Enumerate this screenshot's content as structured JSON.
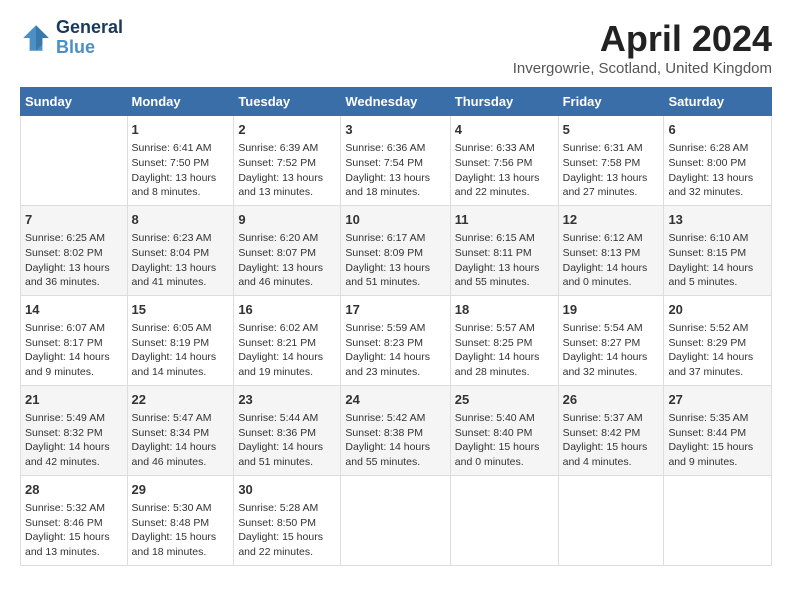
{
  "header": {
    "logo_line1": "General",
    "logo_line2": "Blue",
    "month": "April 2024",
    "location": "Invergowrie, Scotland, United Kingdom"
  },
  "columns": [
    "Sunday",
    "Monday",
    "Tuesday",
    "Wednesday",
    "Thursday",
    "Friday",
    "Saturday"
  ],
  "weeks": [
    [
      {
        "day": "",
        "sunrise": "",
        "sunset": "",
        "daylight": ""
      },
      {
        "day": "1",
        "sunrise": "Sunrise: 6:41 AM",
        "sunset": "Sunset: 7:50 PM",
        "daylight": "Daylight: 13 hours and 8 minutes."
      },
      {
        "day": "2",
        "sunrise": "Sunrise: 6:39 AM",
        "sunset": "Sunset: 7:52 PM",
        "daylight": "Daylight: 13 hours and 13 minutes."
      },
      {
        "day": "3",
        "sunrise": "Sunrise: 6:36 AM",
        "sunset": "Sunset: 7:54 PM",
        "daylight": "Daylight: 13 hours and 18 minutes."
      },
      {
        "day": "4",
        "sunrise": "Sunrise: 6:33 AM",
        "sunset": "Sunset: 7:56 PM",
        "daylight": "Daylight: 13 hours and 22 minutes."
      },
      {
        "day": "5",
        "sunrise": "Sunrise: 6:31 AM",
        "sunset": "Sunset: 7:58 PM",
        "daylight": "Daylight: 13 hours and 27 minutes."
      },
      {
        "day": "6",
        "sunrise": "Sunrise: 6:28 AM",
        "sunset": "Sunset: 8:00 PM",
        "daylight": "Daylight: 13 hours and 32 minutes."
      }
    ],
    [
      {
        "day": "7",
        "sunrise": "Sunrise: 6:25 AM",
        "sunset": "Sunset: 8:02 PM",
        "daylight": "Daylight: 13 hours and 36 minutes."
      },
      {
        "day": "8",
        "sunrise": "Sunrise: 6:23 AM",
        "sunset": "Sunset: 8:04 PM",
        "daylight": "Daylight: 13 hours and 41 minutes."
      },
      {
        "day": "9",
        "sunrise": "Sunrise: 6:20 AM",
        "sunset": "Sunset: 8:07 PM",
        "daylight": "Daylight: 13 hours and 46 minutes."
      },
      {
        "day": "10",
        "sunrise": "Sunrise: 6:17 AM",
        "sunset": "Sunset: 8:09 PM",
        "daylight": "Daylight: 13 hours and 51 minutes."
      },
      {
        "day": "11",
        "sunrise": "Sunrise: 6:15 AM",
        "sunset": "Sunset: 8:11 PM",
        "daylight": "Daylight: 13 hours and 55 minutes."
      },
      {
        "day": "12",
        "sunrise": "Sunrise: 6:12 AM",
        "sunset": "Sunset: 8:13 PM",
        "daylight": "Daylight: 14 hours and 0 minutes."
      },
      {
        "day": "13",
        "sunrise": "Sunrise: 6:10 AM",
        "sunset": "Sunset: 8:15 PM",
        "daylight": "Daylight: 14 hours and 5 minutes."
      }
    ],
    [
      {
        "day": "14",
        "sunrise": "Sunrise: 6:07 AM",
        "sunset": "Sunset: 8:17 PM",
        "daylight": "Daylight: 14 hours and 9 minutes."
      },
      {
        "day": "15",
        "sunrise": "Sunrise: 6:05 AM",
        "sunset": "Sunset: 8:19 PM",
        "daylight": "Daylight: 14 hours and 14 minutes."
      },
      {
        "day": "16",
        "sunrise": "Sunrise: 6:02 AM",
        "sunset": "Sunset: 8:21 PM",
        "daylight": "Daylight: 14 hours and 19 minutes."
      },
      {
        "day": "17",
        "sunrise": "Sunrise: 5:59 AM",
        "sunset": "Sunset: 8:23 PM",
        "daylight": "Daylight: 14 hours and 23 minutes."
      },
      {
        "day": "18",
        "sunrise": "Sunrise: 5:57 AM",
        "sunset": "Sunset: 8:25 PM",
        "daylight": "Daylight: 14 hours and 28 minutes."
      },
      {
        "day": "19",
        "sunrise": "Sunrise: 5:54 AM",
        "sunset": "Sunset: 8:27 PM",
        "daylight": "Daylight: 14 hours and 32 minutes."
      },
      {
        "day": "20",
        "sunrise": "Sunrise: 5:52 AM",
        "sunset": "Sunset: 8:29 PM",
        "daylight": "Daylight: 14 hours and 37 minutes."
      }
    ],
    [
      {
        "day": "21",
        "sunrise": "Sunrise: 5:49 AM",
        "sunset": "Sunset: 8:32 PM",
        "daylight": "Daylight: 14 hours and 42 minutes."
      },
      {
        "day": "22",
        "sunrise": "Sunrise: 5:47 AM",
        "sunset": "Sunset: 8:34 PM",
        "daylight": "Daylight: 14 hours and 46 minutes."
      },
      {
        "day": "23",
        "sunrise": "Sunrise: 5:44 AM",
        "sunset": "Sunset: 8:36 PM",
        "daylight": "Daylight: 14 hours and 51 minutes."
      },
      {
        "day": "24",
        "sunrise": "Sunrise: 5:42 AM",
        "sunset": "Sunset: 8:38 PM",
        "daylight": "Daylight: 14 hours and 55 minutes."
      },
      {
        "day": "25",
        "sunrise": "Sunrise: 5:40 AM",
        "sunset": "Sunset: 8:40 PM",
        "daylight": "Daylight: 15 hours and 0 minutes."
      },
      {
        "day": "26",
        "sunrise": "Sunrise: 5:37 AM",
        "sunset": "Sunset: 8:42 PM",
        "daylight": "Daylight: 15 hours and 4 minutes."
      },
      {
        "day": "27",
        "sunrise": "Sunrise: 5:35 AM",
        "sunset": "Sunset: 8:44 PM",
        "daylight": "Daylight: 15 hours and 9 minutes."
      }
    ],
    [
      {
        "day": "28",
        "sunrise": "Sunrise: 5:32 AM",
        "sunset": "Sunset: 8:46 PM",
        "daylight": "Daylight: 15 hours and 13 minutes."
      },
      {
        "day": "29",
        "sunrise": "Sunrise: 5:30 AM",
        "sunset": "Sunset: 8:48 PM",
        "daylight": "Daylight: 15 hours and 18 minutes."
      },
      {
        "day": "30",
        "sunrise": "Sunrise: 5:28 AM",
        "sunset": "Sunset: 8:50 PM",
        "daylight": "Daylight: 15 hours and 22 minutes."
      },
      {
        "day": "",
        "sunrise": "",
        "sunset": "",
        "daylight": ""
      },
      {
        "day": "",
        "sunrise": "",
        "sunset": "",
        "daylight": ""
      },
      {
        "day": "",
        "sunrise": "",
        "sunset": "",
        "daylight": ""
      },
      {
        "day": "",
        "sunrise": "",
        "sunset": "",
        "daylight": ""
      }
    ]
  ]
}
